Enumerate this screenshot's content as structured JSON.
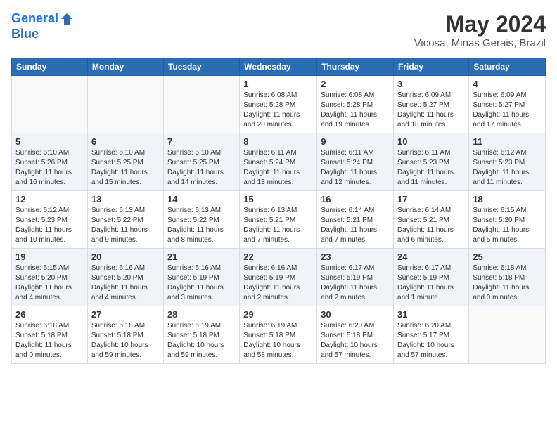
{
  "header": {
    "logo_line1": "General",
    "logo_line2": "Blue",
    "month": "May 2024",
    "location": "Vicosa, Minas Gerais, Brazil"
  },
  "weekdays": [
    "Sunday",
    "Monday",
    "Tuesday",
    "Wednesday",
    "Thursday",
    "Friday",
    "Saturday"
  ],
  "weeks": [
    [
      {
        "day": "",
        "info": ""
      },
      {
        "day": "",
        "info": ""
      },
      {
        "day": "",
        "info": ""
      },
      {
        "day": "1",
        "info": "Sunrise: 6:08 AM\nSunset: 5:28 PM\nDaylight: 11 hours and 20 minutes."
      },
      {
        "day": "2",
        "info": "Sunrise: 6:08 AM\nSunset: 5:28 PM\nDaylight: 11 hours and 19 minutes."
      },
      {
        "day": "3",
        "info": "Sunrise: 6:09 AM\nSunset: 5:27 PM\nDaylight: 11 hours and 18 minutes."
      },
      {
        "day": "4",
        "info": "Sunrise: 6:09 AM\nSunset: 5:27 PM\nDaylight: 11 hours and 17 minutes."
      }
    ],
    [
      {
        "day": "5",
        "info": "Sunrise: 6:10 AM\nSunset: 5:26 PM\nDaylight: 11 hours and 16 minutes."
      },
      {
        "day": "6",
        "info": "Sunrise: 6:10 AM\nSunset: 5:25 PM\nDaylight: 11 hours and 15 minutes."
      },
      {
        "day": "7",
        "info": "Sunrise: 6:10 AM\nSunset: 5:25 PM\nDaylight: 11 hours and 14 minutes."
      },
      {
        "day": "8",
        "info": "Sunrise: 6:11 AM\nSunset: 5:24 PM\nDaylight: 11 hours and 13 minutes."
      },
      {
        "day": "9",
        "info": "Sunrise: 6:11 AM\nSunset: 5:24 PM\nDaylight: 11 hours and 12 minutes."
      },
      {
        "day": "10",
        "info": "Sunrise: 6:11 AM\nSunset: 5:23 PM\nDaylight: 11 hours and 11 minutes."
      },
      {
        "day": "11",
        "info": "Sunrise: 6:12 AM\nSunset: 5:23 PM\nDaylight: 11 hours and 11 minutes."
      }
    ],
    [
      {
        "day": "12",
        "info": "Sunrise: 6:12 AM\nSunset: 5:23 PM\nDaylight: 11 hours and 10 minutes."
      },
      {
        "day": "13",
        "info": "Sunrise: 6:13 AM\nSunset: 5:22 PM\nDaylight: 11 hours and 9 minutes."
      },
      {
        "day": "14",
        "info": "Sunrise: 6:13 AM\nSunset: 5:22 PM\nDaylight: 11 hours and 8 minutes."
      },
      {
        "day": "15",
        "info": "Sunrise: 6:13 AM\nSunset: 5:21 PM\nDaylight: 11 hours and 7 minutes."
      },
      {
        "day": "16",
        "info": "Sunrise: 6:14 AM\nSunset: 5:21 PM\nDaylight: 11 hours and 7 minutes."
      },
      {
        "day": "17",
        "info": "Sunrise: 6:14 AM\nSunset: 5:21 PM\nDaylight: 11 hours and 6 minutes."
      },
      {
        "day": "18",
        "info": "Sunrise: 6:15 AM\nSunset: 5:20 PM\nDaylight: 11 hours and 5 minutes."
      }
    ],
    [
      {
        "day": "19",
        "info": "Sunrise: 6:15 AM\nSunset: 5:20 PM\nDaylight: 11 hours and 4 minutes."
      },
      {
        "day": "20",
        "info": "Sunrise: 6:16 AM\nSunset: 5:20 PM\nDaylight: 11 hours and 4 minutes."
      },
      {
        "day": "21",
        "info": "Sunrise: 6:16 AM\nSunset: 5:19 PM\nDaylight: 11 hours and 3 minutes."
      },
      {
        "day": "22",
        "info": "Sunrise: 6:16 AM\nSunset: 5:19 PM\nDaylight: 11 hours and 2 minutes."
      },
      {
        "day": "23",
        "info": "Sunrise: 6:17 AM\nSunset: 5:19 PM\nDaylight: 11 hours and 2 minutes."
      },
      {
        "day": "24",
        "info": "Sunrise: 6:17 AM\nSunset: 5:19 PM\nDaylight: 11 hours and 1 minute."
      },
      {
        "day": "25",
        "info": "Sunrise: 6:18 AM\nSunset: 5:18 PM\nDaylight: 11 hours and 0 minutes."
      }
    ],
    [
      {
        "day": "26",
        "info": "Sunrise: 6:18 AM\nSunset: 5:18 PM\nDaylight: 11 hours and 0 minutes."
      },
      {
        "day": "27",
        "info": "Sunrise: 6:18 AM\nSunset: 5:18 PM\nDaylight: 10 hours and 59 minutes."
      },
      {
        "day": "28",
        "info": "Sunrise: 6:19 AM\nSunset: 5:18 PM\nDaylight: 10 hours and 59 minutes."
      },
      {
        "day": "29",
        "info": "Sunrise: 6:19 AM\nSunset: 5:18 PM\nDaylight: 10 hours and 58 minutes."
      },
      {
        "day": "30",
        "info": "Sunrise: 6:20 AM\nSunset: 5:18 PM\nDaylight: 10 hours and 57 minutes."
      },
      {
        "day": "31",
        "info": "Sunrise: 6:20 AM\nSunset: 5:17 PM\nDaylight: 10 hours and 57 minutes."
      },
      {
        "day": "",
        "info": ""
      }
    ]
  ]
}
